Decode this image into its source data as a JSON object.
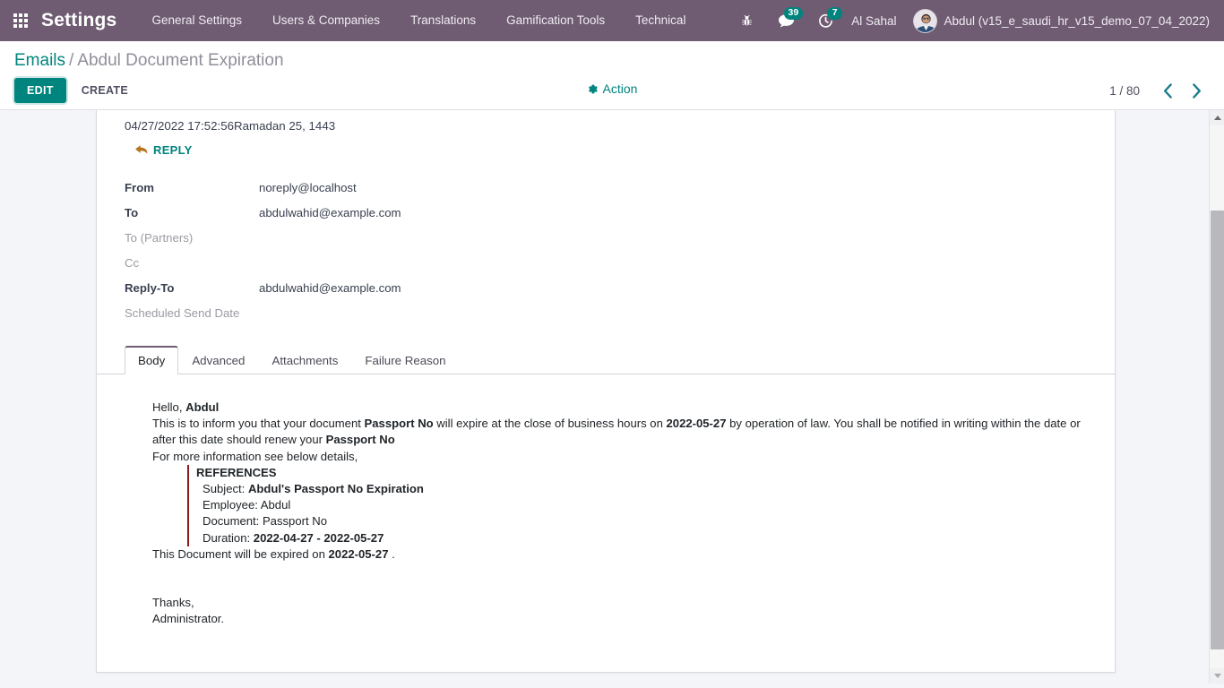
{
  "navbar": {
    "apps_icon": "grid-apps-icon",
    "brand": "Settings",
    "menu_items": [
      {
        "label": "General Settings"
      },
      {
        "label": "Users & Companies"
      },
      {
        "label": "Translations"
      },
      {
        "label": "Gamification Tools"
      },
      {
        "label": "Technical"
      }
    ],
    "systray": {
      "debug_icon": "bug-icon",
      "messages_icon": "chat-bubble-icon",
      "messages_count": "39",
      "activities_icon": "clock-activity-icon",
      "activities_count": "7",
      "company": "Al Sahal",
      "avatar_icon": "user-avatar",
      "user_label": "Abdul (v15_e_saudi_hr_v15_demo_07_04_2022)"
    },
    "accent": "#00847e",
    "bg": "#6f5b72"
  },
  "control_panel": {
    "breadcrumb": {
      "parent": "Emails",
      "separator": "/",
      "current": "Abdul Document Expiration"
    },
    "edit_label": "EDIT",
    "create_label": "CREATE",
    "action_icon": "gear-icon",
    "action_label": "Action",
    "pager": {
      "text": "1 / 80",
      "prev_icon": "chevron-left-icon",
      "next_icon": "chevron-right-icon"
    }
  },
  "record": {
    "datestamp": "04/27/2022 17:52:56Ramadan 25, 1443",
    "reply_icon": "reply-arrow-icon",
    "reply_label": "REPLY",
    "fields": [
      {
        "label": "From",
        "value": "noreply@localhost",
        "muted": false
      },
      {
        "label": "To",
        "value": "abdulwahid@example.com",
        "muted": false
      },
      {
        "label": "To (Partners)",
        "value": "",
        "muted": true
      },
      {
        "label": "Cc",
        "value": "",
        "muted": true
      },
      {
        "label": "Reply-To",
        "value": "abdulwahid@example.com",
        "muted": false
      },
      {
        "label": "Scheduled Send Date",
        "value": "",
        "muted": true
      }
    ],
    "tabs": [
      {
        "label": "Body",
        "active": true
      },
      {
        "label": "Advanced",
        "active": false
      },
      {
        "label": "Attachments",
        "active": false
      },
      {
        "label": "Failure Reason",
        "active": false
      }
    ],
    "body": {
      "greeting_plain": "Hello, ",
      "greeting_bold": "Abdul",
      "para1_a": "This is to inform you that your document ",
      "para1_b": "Passport No",
      "para1_c": " will expire at the close of business hours on ",
      "para1_d": "2022-05-27",
      "para1_e": " by operation of law. You shall be notified in writing within the date or after this date should renew your ",
      "para1_f": "Passport No",
      "para2": "For more information see below details,",
      "references": {
        "title": "REFERENCES",
        "subject_label": "Subject: ",
        "subject_value": "Abdul's Passport No Expiration",
        "employee_label": "Employee: ",
        "employee_value": "Abdul",
        "document_label": "Document: ",
        "document_value": "Passport No",
        "duration_label": "Duration: ",
        "duration_value": "2022-04-27 - 2022-05-27"
      },
      "expiry_a": "This Document will be expired on ",
      "expiry_b": "2022-05-27",
      "expiry_c": " .",
      "sign_thanks": "Thanks,",
      "sign_name": "Administrator."
    }
  },
  "scrollbar": {
    "up_icon": "scroll-up-arrow-icon",
    "down_icon": "scroll-down-arrow-icon"
  }
}
